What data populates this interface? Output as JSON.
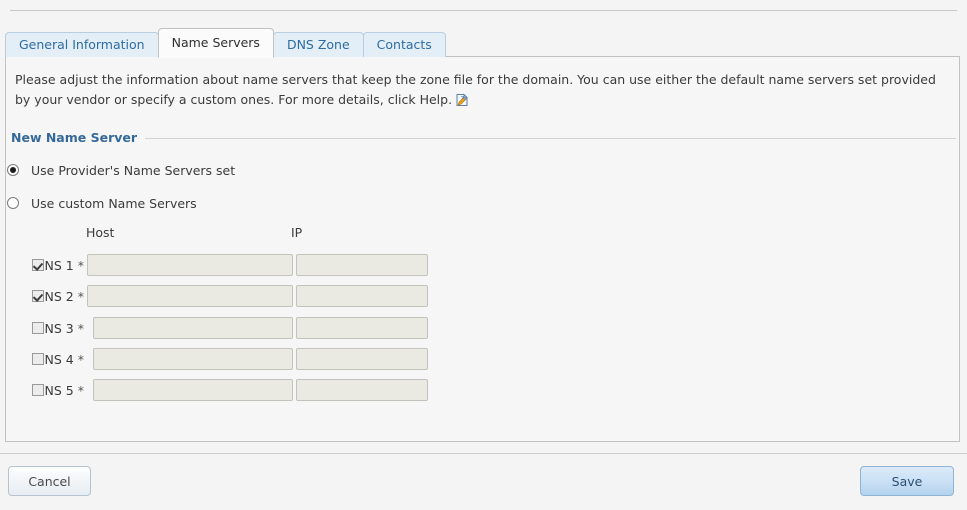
{
  "tabs": [
    {
      "label": "General Information",
      "active": false
    },
    {
      "label": "Name Servers",
      "active": true
    },
    {
      "label": "DNS Zone",
      "active": false
    },
    {
      "label": "Contacts",
      "active": false
    }
  ],
  "intro": {
    "text": "Please adjust the information about name servers that keep the zone file for the domain. You can use either the default name servers set provided by your vendor or specify a custom ones. For more details, click Help.",
    "help_icon": "help-document-icon"
  },
  "section": {
    "legend": "New Name Server"
  },
  "options": [
    {
      "label": "Use Provider's Name Servers set",
      "selected": true
    },
    {
      "label": "Use custom Name Servers",
      "selected": false
    }
  ],
  "table": {
    "columns": [
      "Host",
      "IP"
    ],
    "rows": [
      {
        "label": "NS 1",
        "required": "*",
        "checked": true,
        "host": "",
        "ip": ""
      },
      {
        "label": "NS 2",
        "required": "*",
        "checked": true,
        "host": "",
        "ip": ""
      },
      {
        "label": "NS 3",
        "required": "*",
        "checked": false,
        "host": "",
        "ip": ""
      },
      {
        "label": "NS 4",
        "required": "*",
        "checked": false,
        "host": "",
        "ip": ""
      },
      {
        "label": "NS 5",
        "required": "*",
        "checked": false,
        "host": "",
        "ip": ""
      }
    ]
  },
  "buttons": {
    "cancel": "Cancel",
    "save": "Save"
  },
  "colors": {
    "legend": "#34699a",
    "tab_link": "#2d6ca2",
    "field_bg": "#eaeae2",
    "save_accent": "#b3d3ee"
  }
}
